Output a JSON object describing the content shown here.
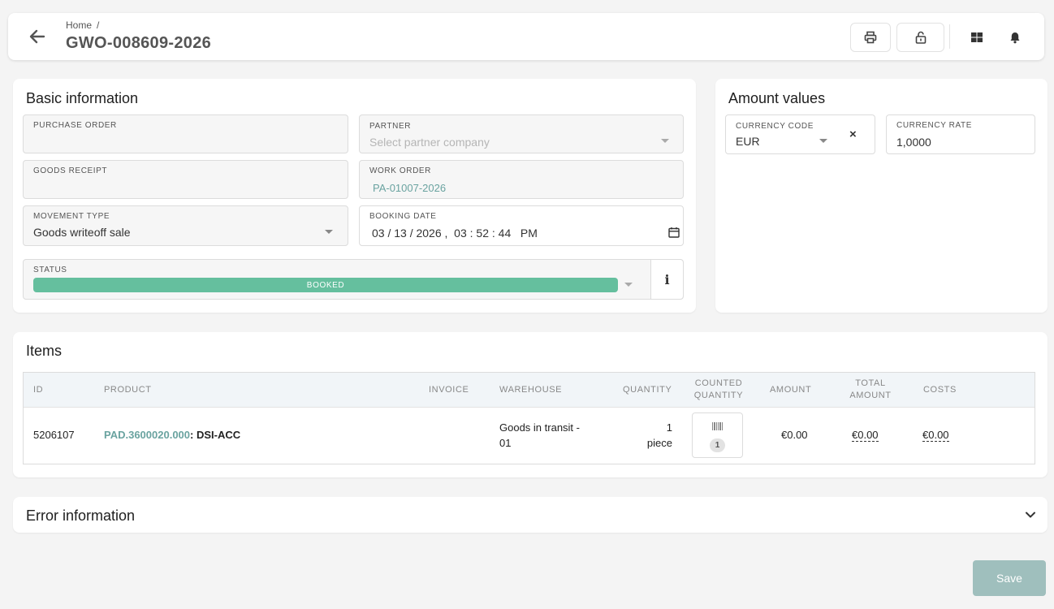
{
  "header": {
    "breadcrumb_home": "Home",
    "breadcrumb_sep": "/",
    "title": "GWO-008609-2026"
  },
  "basic": {
    "title": "Basic information",
    "purchase_order": {
      "label": "PURCHASE ORDER",
      "value": ""
    },
    "partner": {
      "label": "PARTNER",
      "placeholder": "Select partner company"
    },
    "goods_receipt": {
      "label": "GOODS RECEIPT",
      "value": ""
    },
    "work_order": {
      "label": "WORK ORDER",
      "value": "PA-01007-2026"
    },
    "movement_type": {
      "label": "MOVEMENT TYPE",
      "value": "Goods writeoff sale"
    },
    "booking_date": {
      "label": "BOOKING DATE",
      "value": "03 / 13 / 2026 ,  03 : 52 : 44   PM"
    },
    "status": {
      "label": "STATUS",
      "value": "BOOKED",
      "color": "#65bf9e"
    },
    "info_glyph": "i"
  },
  "amount": {
    "title": "Amount values",
    "currency_code": {
      "label": "CURRENCY CODE",
      "value": "EUR",
      "clear": "×"
    },
    "currency_rate": {
      "label": "CURRENCY RATE",
      "value": "1,0000"
    }
  },
  "items": {
    "title": "Items",
    "columns": {
      "id": "ID",
      "product": "PRODUCT",
      "invoice": "INVOICE",
      "warehouse": "WAREHOUSE",
      "quantity": "QUANTITY",
      "counted_1": "COUNTED",
      "counted_2": "QUANTITY",
      "amount": "AMOUNT",
      "total_1": "TOTAL",
      "total_2": "AMOUNT",
      "costs": "COSTS"
    },
    "rows": [
      {
        "id": "5206107",
        "product_code": "PAD.3600020.000",
        "product_name": ": DSI-ACC",
        "invoice": "",
        "warehouse_1": "Goods in transit -",
        "warehouse_2": "01",
        "quantity_1": "1",
        "quantity_2": "piece",
        "counted_badge": "1",
        "amount": "€0.00",
        "total_amount": "€0.00",
        "costs": "€0.00"
      }
    ]
  },
  "errors": {
    "title": "Error information"
  },
  "footer": {
    "save_label": "Save"
  },
  "colors": {
    "accent": "#6aa3a0",
    "status_booked": "#65bf9e",
    "save_disabled": "#9fbfbd"
  }
}
